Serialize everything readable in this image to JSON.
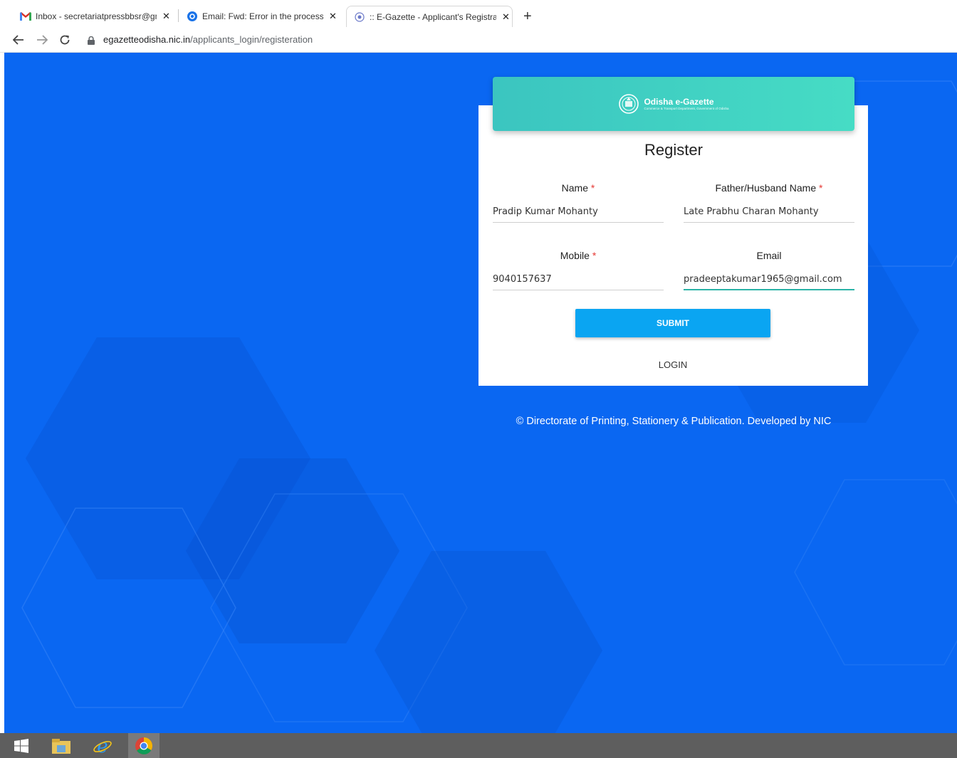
{
  "browser": {
    "tabs": [
      {
        "title": "Inbox - secretariatpressbbsr@gm",
        "icon": "gmail-icon",
        "active": false
      },
      {
        "title": "Email: Fwd: Error in the process c",
        "icon": "mail-at-icon",
        "active": false
      },
      {
        "title": ":: E-Gazette - Applicant's Registra",
        "icon": "odisha-emblem-icon",
        "active": true
      }
    ],
    "close_glyph": "✕",
    "new_tab_glyph": "+",
    "url_host": "egazetteodisha.nic.in",
    "url_path": "/applicants_login/registeration"
  },
  "brand": {
    "title": "Odisha e-Gazette",
    "subtitle": "Commerce & Transport Department, Government of Odisha"
  },
  "form": {
    "title": "Register",
    "required_mark": "*",
    "name_label": "Name",
    "name_value": "Pradip Kumar Mohanty",
    "father_label": "Father/Husband Name",
    "father_value": "Late Prabhu Charan Mohanty",
    "mobile_label": "Mobile",
    "mobile_value": "9040157637",
    "email_label": "Email",
    "email_value": "pradeeptakumar1965@gmail.com",
    "submit_label": "SUBMIT",
    "login_label": "LOGIN"
  },
  "footer": {
    "text": "© Directorate of Printing, Stationery & Publication. Developed by NIC"
  },
  "colors": {
    "page_bg": "#0a67f2",
    "header_gradient_start": "#3bc5c0",
    "header_gradient_end": "#46dcc5",
    "submit_bg": "#0aa5f2",
    "required": "#e53935",
    "taskbar": "#5e5e5e"
  },
  "taskbar": {
    "items": [
      "windows-start-icon",
      "file-explorer-icon",
      "internet-explorer-icon",
      "chrome-icon"
    ]
  }
}
